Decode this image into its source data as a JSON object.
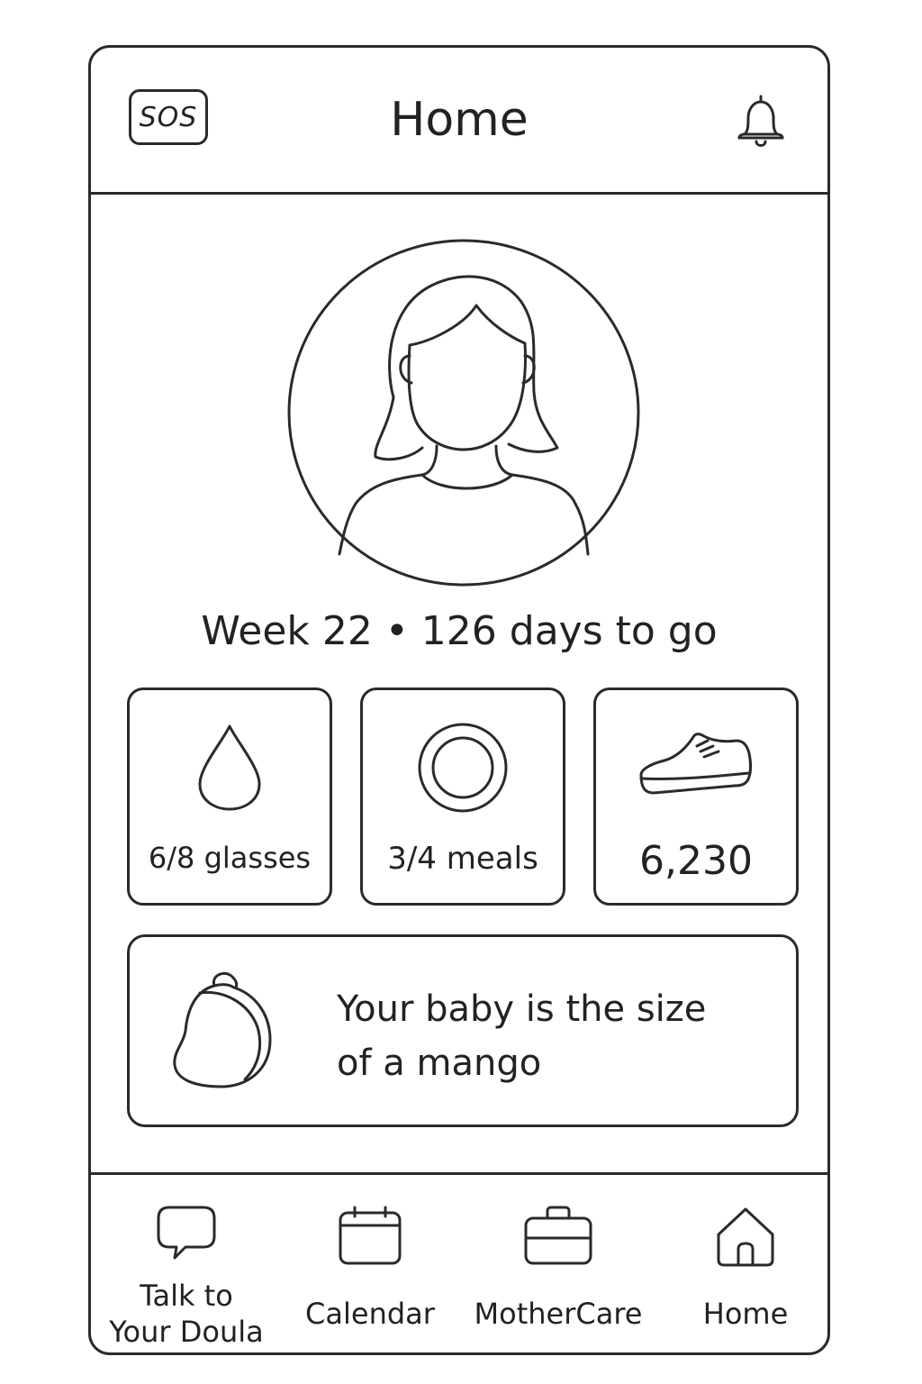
{
  "header": {
    "sos_label": "SOS",
    "title": "Home"
  },
  "profile": {
    "status": "Week 22 • 126 days to go"
  },
  "stats": [
    {
      "icon": "water-drop-icon",
      "value": "6/8 glasses"
    },
    {
      "icon": "plate-icon",
      "value": "3/4 meals"
    },
    {
      "icon": "sneaker-icon",
      "value": "6,230"
    }
  ],
  "baby_size": {
    "icon": "mango-icon",
    "line1": "Your baby is the size",
    "line2": "of a mango"
  },
  "nav": [
    {
      "icon": "chat-bubble-icon",
      "line1": "Talk to",
      "line2": "Your Doula"
    },
    {
      "icon": "calendar-icon",
      "label": "Calendar"
    },
    {
      "icon": "briefcase-icon",
      "label": "MotherCare"
    },
    {
      "icon": "home-icon",
      "label": "Home"
    }
  ]
}
